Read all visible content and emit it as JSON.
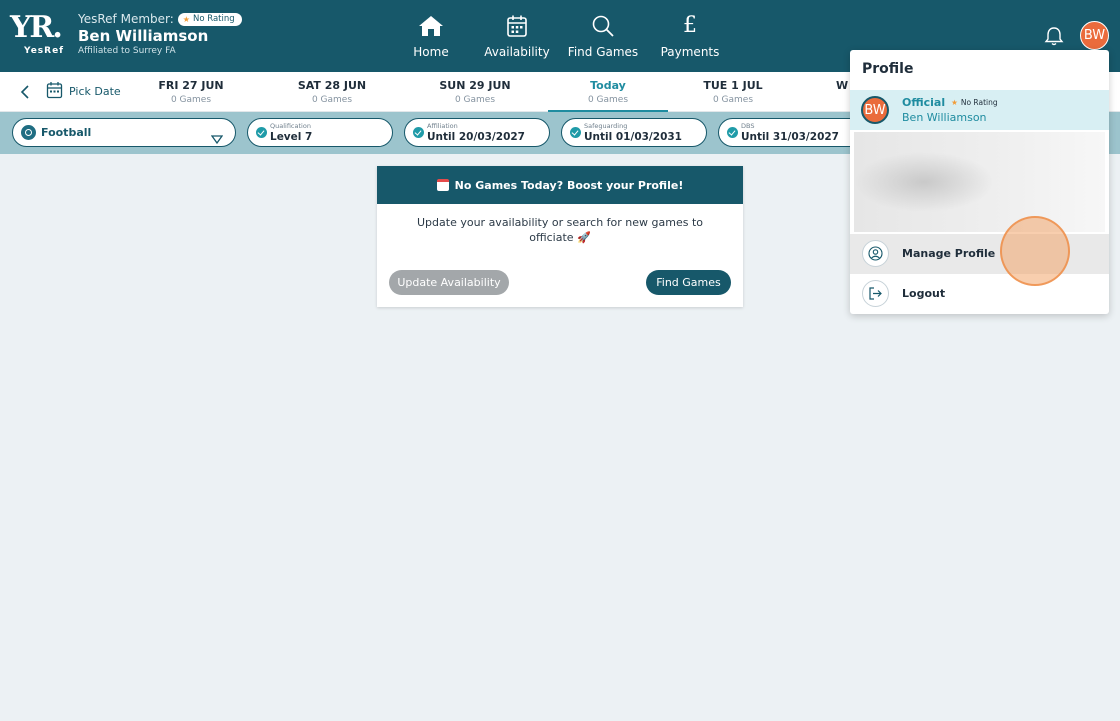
{
  "header": {
    "logo_text": "YR.",
    "logo_sub": "YesRef",
    "member_label": "YesRef Member:",
    "rating_badge": "No Rating",
    "user_name": "Ben Williamson",
    "affiliation": "Affiliated to Surrey FA",
    "nav": [
      {
        "label": "Home",
        "icon": "home-icon"
      },
      {
        "label": "Availability",
        "icon": "calendar-icon"
      },
      {
        "label": "Find Games",
        "icon": "search-icon"
      },
      {
        "label": "Payments",
        "icon": "pound-icon"
      }
    ],
    "avatar_initials": "BW"
  },
  "datebar": {
    "pick_date": "Pick Date",
    "days": [
      {
        "label": "FRI 27 JUN",
        "games": "0 Games"
      },
      {
        "label": "SAT 28 JUN",
        "games": "0 Games"
      },
      {
        "label": "SUN 29 JUN",
        "games": "0 Games"
      },
      {
        "label": "Today",
        "games": "0 Games"
      },
      {
        "label": "TUE 1 JUL",
        "games": "0 Games"
      },
      {
        "label": "W",
        "games": ""
      }
    ],
    "active_index": 3
  },
  "filters": {
    "sport": "Football",
    "chips": [
      {
        "label": "Qualification",
        "value": "Level 7"
      },
      {
        "label": "Affiliation",
        "value": "Until 20/03/2027"
      },
      {
        "label": "Safeguarding",
        "value": "Until 01/03/2031"
      },
      {
        "label": "DBS",
        "value": "Until 31/03/2027"
      }
    ]
  },
  "card": {
    "title": "No Games Today? Boost your Profile!",
    "body": "Update your availability or search for new games to officiate",
    "update_button": "Update Availability",
    "find_button": "Find Games"
  },
  "dropdown": {
    "title": "Profile",
    "initials": "BW",
    "role": "Official",
    "rating": "No Rating",
    "name": "Ben Williamson",
    "manage": "Manage Profile",
    "logout": "Logout"
  },
  "colors": {
    "brand": "#17586a",
    "accent": "#1f8ca0",
    "avatar": "#ea6b3c",
    "filter_bg": "#9cc4cd"
  }
}
